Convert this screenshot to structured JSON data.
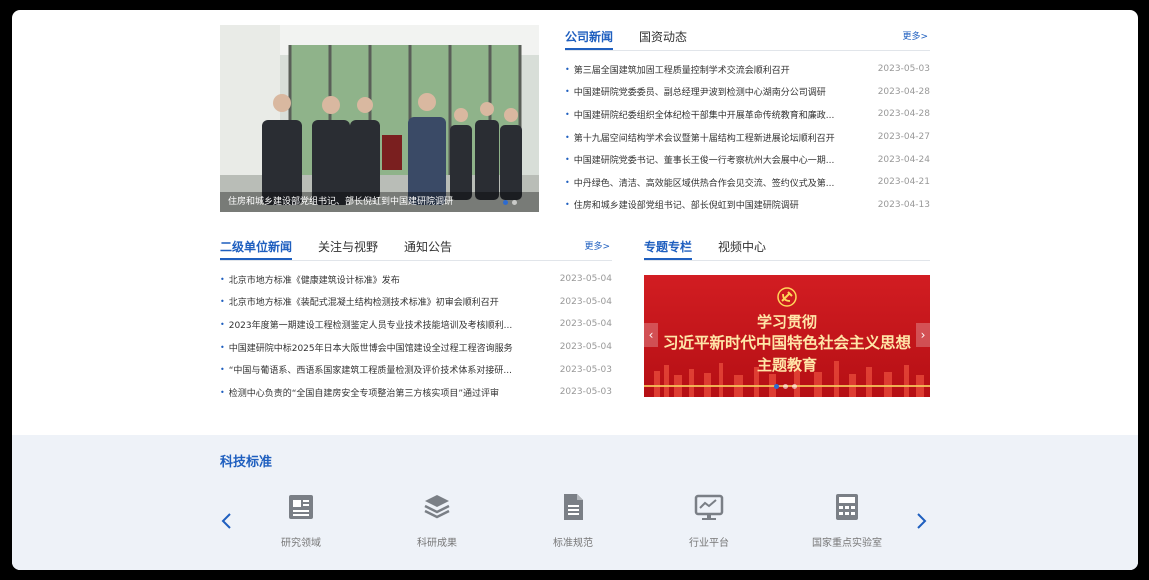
{
  "hero": {
    "caption": "住房和城乡建设部党组书记、部长倪虹到中国建研院调研"
  },
  "company_news": {
    "tabs": [
      "公司新闻",
      "国资动态"
    ],
    "more": "更多>",
    "items": [
      {
        "title": "第三届全国建筑加固工程质量控制学术交流会顺利召开",
        "date": "2023-05-03"
      },
      {
        "title": "中国建研院党委委员、副总经理尹波到检测中心湖南分公司调研",
        "date": "2023-04-28"
      },
      {
        "title": "中国建研院纪委组织全体纪检干部集中开展革命传统教育和廉政...",
        "date": "2023-04-28"
      },
      {
        "title": "第十九届空间结构学术会议暨第十届结构工程新进展论坛顺利召开",
        "date": "2023-04-27"
      },
      {
        "title": "中国建研院党委书记、董事长王俊一行考察杭州大会展中心一期...",
        "date": "2023-04-24"
      },
      {
        "title": "中丹绿色、清洁、高效能区域供热合作会见交流、签约仪式及第...",
        "date": "2023-04-21"
      },
      {
        "title": "住房和城乡建设部党组书记、部长倪虹到中国建研院调研",
        "date": "2023-04-13"
      }
    ]
  },
  "sub_news": {
    "tabs": [
      "二级单位新闻",
      "关注与视野",
      "通知公告"
    ],
    "more": "更多>",
    "items": [
      {
        "title": "北京市地方标准《健康建筑设计标准》发布",
        "date": "2023-05-04"
      },
      {
        "title": "北京市地方标准《装配式混凝土结构检测技术标准》初审会顺利召开",
        "date": "2023-05-04"
      },
      {
        "title": "2023年度第一期建设工程检测鉴定人员专业技术技能培训及考核顺利...",
        "date": "2023-05-04"
      },
      {
        "title": "中国建研院中标2025年日本大阪世博会中国馆建设全过程工程咨询服务",
        "date": "2023-05-04"
      },
      {
        "title": "“中国与葡语系、西语系国家建筑工程质量检测及评价技术体系对接研...",
        "date": "2023-05-03"
      },
      {
        "title": "检测中心负责的“全国自建房安全专项整治第三方核实项目”通过评审",
        "date": "2023-05-03"
      }
    ]
  },
  "special": {
    "tabs": [
      "专题专栏",
      "视频中心"
    ],
    "banner": {
      "line1": "学习贯彻",
      "line2": "习近平新时代中国特色社会主义思想",
      "line3": "主题教育"
    }
  },
  "tech": {
    "title": "科技标准",
    "items": [
      {
        "label": "研究领域",
        "icon": "newspaper-icon"
      },
      {
        "label": "科研成果",
        "icon": "layers-icon"
      },
      {
        "label": "标准规范",
        "icon": "document-icon"
      },
      {
        "label": "行业平台",
        "icon": "monitor-chart-icon"
      },
      {
        "label": "国家重点实验室",
        "icon": "calculator-icon"
      }
    ]
  }
}
